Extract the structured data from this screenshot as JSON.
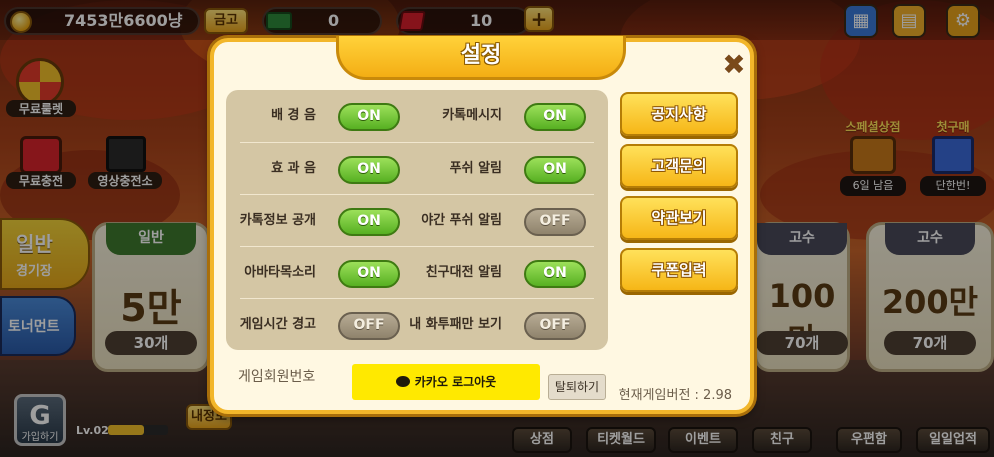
{
  "topbar": {
    "gold": "7453만6600냥",
    "vault_label": "금고",
    "cash_count": "0",
    "ruby_count": "10",
    "add_label": "+"
  },
  "left_menu": {
    "roulette": "무료룰렛",
    "free_charge": "무료충전",
    "video_charge": "영상충전소",
    "mode_general": "일반",
    "mode_general_sub": "경기장",
    "tournament": "토너먼트",
    "level": "Lv.02",
    "join": "가입하기"
  },
  "mode_cards": [
    {
      "tab": "일반",
      "value": "5만",
      "count": "30개"
    },
    {
      "tab": "고수",
      "value": "100만",
      "count": "70개"
    },
    {
      "tab": "고수",
      "value": "200만",
      "count": "70개"
    }
  ],
  "right_menu": {
    "special_shop": "스페셜상점",
    "days_left": "6일 남음",
    "first_purchase": "첫구매",
    "once_only": "단한번!"
  },
  "bottom_bar": {
    "my_info": "내정보",
    "shop": "상점",
    "ticket_world": "티켓월드",
    "event": "이벤트",
    "friend": "친구",
    "mailbox": "우편함",
    "daily_mission": "일일업적"
  },
  "dialog": {
    "title": "설정",
    "close_symbol": "✖",
    "settings": [
      {
        "left_label": "배 경 음",
        "left_state": "ON",
        "right_label": "카톡메시지",
        "right_state": "ON"
      },
      {
        "left_label": "효 과 음",
        "left_state": "ON",
        "right_label": "푸쉬 알림",
        "right_state": "ON"
      },
      {
        "left_label": "카톡정보 공개",
        "left_state": "ON",
        "right_label": "야간 푸쉬 알림",
        "right_state": "OFF"
      },
      {
        "left_label": "아바타목소리",
        "left_state": "ON",
        "right_label": "친구대전 알림",
        "right_state": "ON"
      },
      {
        "left_label": "게임시간 경고",
        "left_state": "OFF",
        "right_label": "내 화투패만 보기",
        "right_state": "OFF"
      }
    ],
    "menu_buttons": [
      "공지사항",
      "고객문의",
      "약관보기",
      "쿠폰입력"
    ],
    "member_number_label": "게임회원번호",
    "kakao_logout": "카카오 로그아웃",
    "withdraw": "탈퇴하기",
    "version": "현재게임버전 : 2.98"
  },
  "colors": {
    "dialog_border": "#f2b62a",
    "toggle_on": "#57b022",
    "toggle_off": "#8f836c",
    "kakao_yellow": "#ffe900"
  }
}
